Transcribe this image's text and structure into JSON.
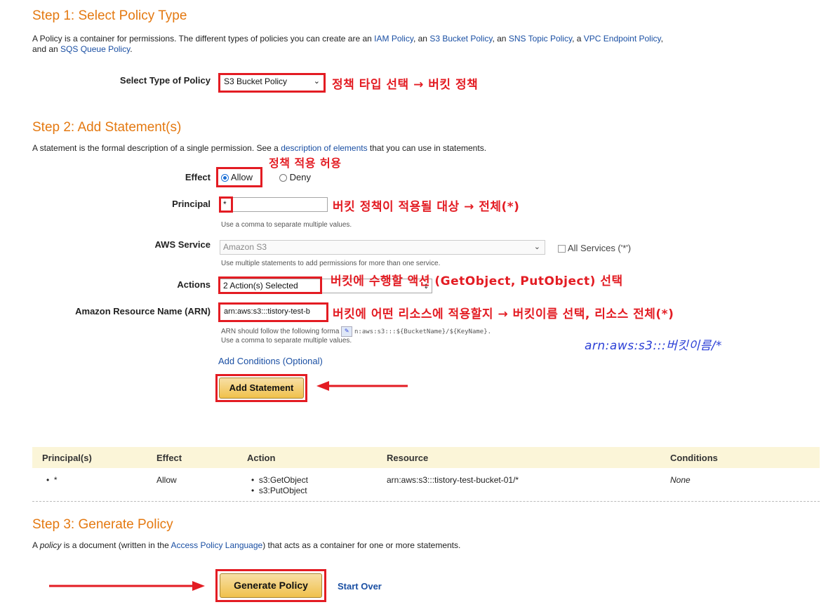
{
  "step1": {
    "title": "Step 1: Select Policy Type",
    "desc_prefix": "A Policy is a container for permissions. The different types of policies you can create are an ",
    "link_iam": "IAM Policy",
    "sep1": ", an ",
    "link_s3": "S3 Bucket Policy",
    "sep2": ", an ",
    "link_sns": "SNS Topic Policy",
    "sep3": ", a ",
    "link_vpc": "VPC Endpoint Policy",
    "sep4": ",",
    "desc_line2_prefix": "and an ",
    "link_sqs": "SQS Queue Policy",
    "desc_end": ".",
    "select_label": "Select Type of Policy",
    "select_value": "S3 Bucket Policy",
    "annotation": "정책 타입 선택 → 버킷 정책"
  },
  "step2": {
    "title": "Step 2: Add Statement(s)",
    "desc_prefix": "A statement is the formal description of a single permission. See a ",
    "desc_link": "description of elements",
    "desc_suffix": " that you can use in statements.",
    "effect_label": "Effect",
    "effect_allow": "Allow",
    "effect_deny": "Deny",
    "effect_annotation": "정책 적용 허용",
    "principal_label": "Principal",
    "principal_value": "*",
    "principal_hint": "Use a comma to separate multiple values.",
    "principal_annotation": "버킷 정책이 적용될 대상 → 전체(*)",
    "service_label": "AWS Service",
    "service_value": "Amazon S3",
    "service_all": "All Services ('*')",
    "service_hint": "Use multiple statements to add permissions for more than one service.",
    "actions_label": "Actions",
    "actions_value": "2 Action(s) Selected",
    "actions_annotation": "버킷에 수행할 액션 (GetObject, PutObject) 선택",
    "arn_label": "Amazon Resource Name (ARN)",
    "arn_value": "arn:aws:s3:::tistory-test-b",
    "arn_hint1_prefix": "ARN should follow the following forma",
    "arn_hint1_suffix": "n:aws:s3:::${BucketName}/${KeyName}.",
    "arn_hint2": "Use a comma to separate multiple values.",
    "arn_annotation": "버킷에 어떤 리소스에 적용할지 → 버킷이름 선택, 리소스 전체(*)",
    "arn_annotation2": "arn:aws:s3:::버킷이름/*",
    "add_conditions": "Add Conditions (Optional)",
    "add_statement": "Add Statement"
  },
  "table": {
    "headers": [
      "Principal(s)",
      "Effect",
      "Action",
      "Resource",
      "Conditions"
    ],
    "row": {
      "principal": "*",
      "effect": "Allow",
      "actions": [
        "s3:GetObject",
        "s3:PutObject"
      ],
      "resource": "arn:aws:s3:::tistory-test-bucket-01/*",
      "conditions": "None"
    }
  },
  "step3": {
    "title": "Step 3: Generate Policy",
    "desc_p1": "A ",
    "desc_em": "policy",
    "desc_p2": " is a document (written in the ",
    "desc_link": "Access Policy Language",
    "desc_p3": ") that acts as a container for one or more statements.",
    "generate": "Generate Policy",
    "start_over": "Start Over"
  },
  "colors": {
    "accent": "#e47911",
    "link": "#1a4fa3",
    "annotation_red": "#e31c23",
    "annotation_blue": "#2b3fd6"
  },
  "icons": [
    "chevron-down-icon",
    "red-arrow-icon",
    "clipboard-icon"
  ]
}
